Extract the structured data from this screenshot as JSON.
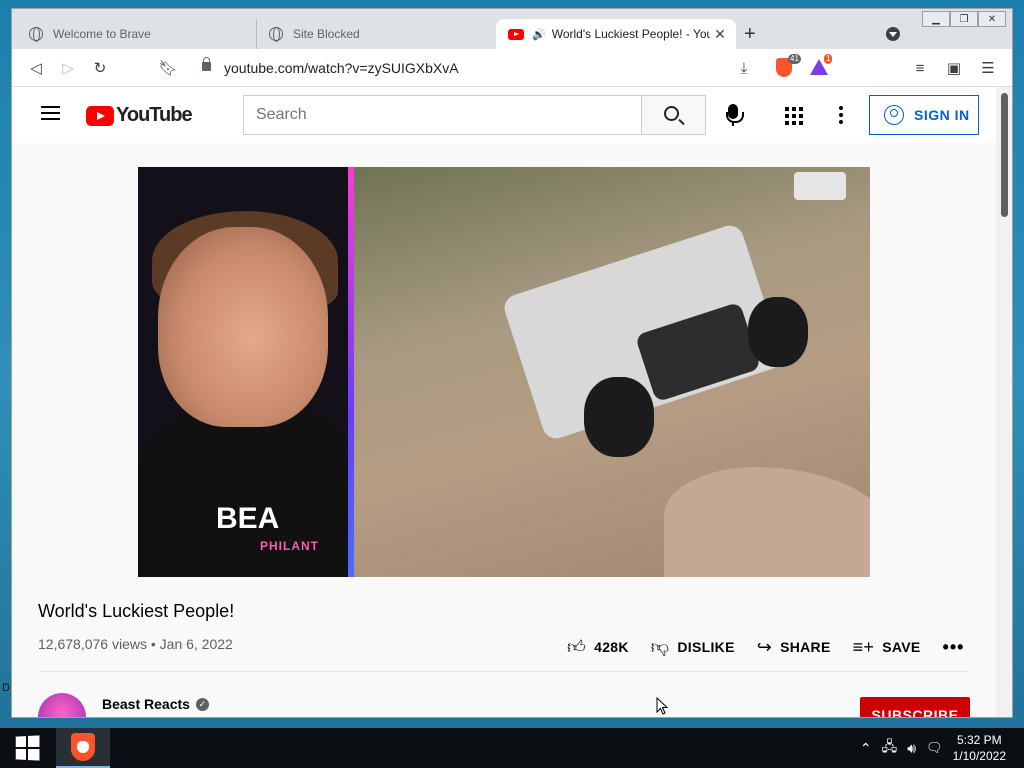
{
  "desktop": {
    "edge_text": "D"
  },
  "browser": {
    "tabs": [
      {
        "title": "Welcome to Brave"
      },
      {
        "title": "Site Blocked"
      },
      {
        "title": "World's Luckiest People! - You"
      }
    ],
    "new_tab_label": "+",
    "url": "youtube.com/watch?v=zySUIGXbXvA",
    "shield_count": "41",
    "rewards_count": "1"
  },
  "youtube": {
    "logo_text": "YouTube",
    "search_placeholder": "Search",
    "sign_in_label": "SIGN IN"
  },
  "video": {
    "shirt_text": "BEA",
    "shirt_subtext": "PHILANT",
    "title": "World's Luckiest People!",
    "views": "12,678,076 views",
    "date": "Jan 6, 2022",
    "likes": "428K",
    "dislike_label": "DISLIKE",
    "share_label": "SHARE",
    "save_label": "SAVE",
    "more_label": "•••"
  },
  "channel": {
    "name": "Beast Reacts",
    "subscribe_label": "SUBSCRIBE"
  },
  "taskbar": {
    "time": "5:32 PM",
    "date": "1/10/2022"
  },
  "colors": {
    "yt_red": "#ff0000",
    "subscribe_red": "#cc0000",
    "signin_blue": "#065fd4",
    "brave_orange": "#fb542b"
  }
}
